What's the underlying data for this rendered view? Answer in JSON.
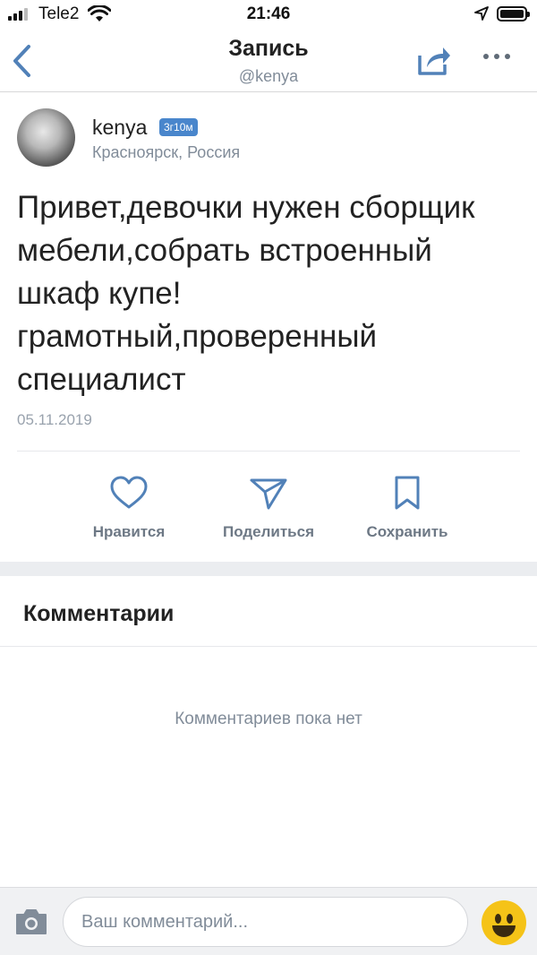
{
  "status_bar": {
    "carrier": "Tele2",
    "time": "21:46"
  },
  "nav": {
    "title": "Запись",
    "subtitle": "@kenya",
    "icons": [
      "back-chevron-icon",
      "share-icon",
      "more-icon"
    ]
  },
  "post": {
    "author": "kenya",
    "time_badge": "3г10м",
    "location": "Красноярск, Россия",
    "text_lines": [
      "Привет,девочки нужен сборщик",
      "мебели,собрать встроенный",
      "шкаф купе!",
      "грамотный,проверенный",
      "специалист"
    ],
    "date": "05.11.2019"
  },
  "actions": [
    {
      "label": "Нравится",
      "icon": "heart-icon"
    },
    {
      "label": "Поделиться",
      "icon": "send-icon"
    },
    {
      "label": "Сохранить",
      "icon": "bookmark-icon"
    }
  ],
  "comments": {
    "title": "Комментарии",
    "empty_text": "Комментариев пока нет"
  },
  "composer": {
    "placeholder": "Ваш комментарий...",
    "value": ""
  },
  "colors": {
    "accent": "#4986cc",
    "secondary_text": "#818c99",
    "action_text": "#6d7885",
    "icon": "#606b77",
    "emoji": "#f5c318"
  }
}
